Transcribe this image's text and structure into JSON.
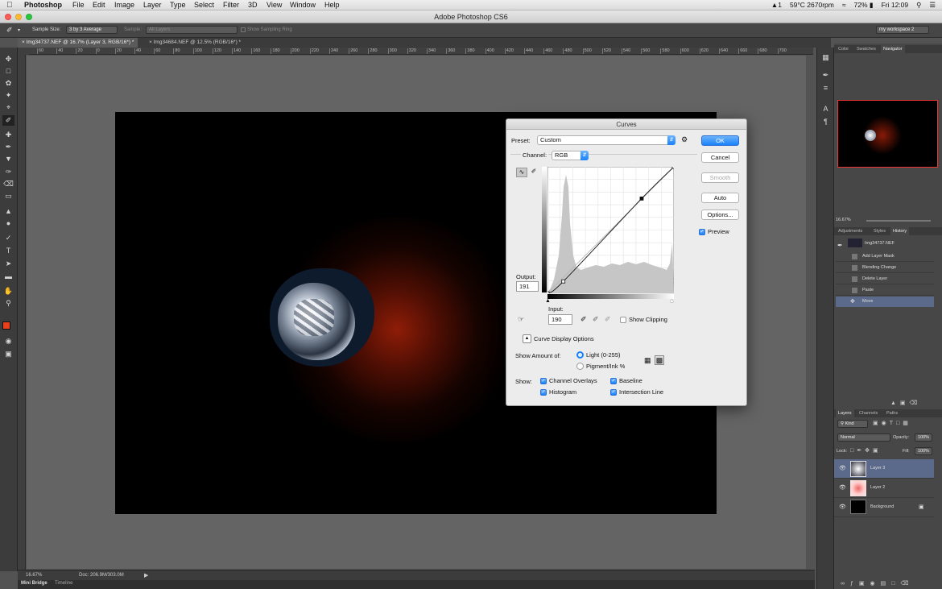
{
  "menubar": {
    "app": "Photoshop",
    "items": [
      "File",
      "Edit",
      "Image",
      "Layer",
      "Type",
      "Select",
      "Filter",
      "3D",
      "View",
      "Window",
      "Help"
    ],
    "status": {
      "adobe": "1",
      "temp": "59°C 2670rpm",
      "battery": "72%",
      "clock": "Fri 12:09"
    }
  },
  "window": {
    "title": "Adobe Photoshop CS6"
  },
  "options_bar": {
    "sample_size_label": "Sample Size:",
    "sample_size_value": "3 by 3 Average",
    "sample_label": "Sample:",
    "sample_value": "All Layers",
    "show_ring": "Show Sampling Ring",
    "workspace": "my workspace 2"
  },
  "tabs": [
    {
      "label": "Img34737.NEF @ 16.7% (Layer 3, RGB/16*) *"
    },
    {
      "label": "Img34684.NEF @ 12.5% (RGB/16*) *"
    }
  ],
  "ruler_ticks": [
    "60",
    "40",
    "20",
    "0",
    "20",
    "40",
    "60",
    "80",
    "100",
    "120",
    "140",
    "160",
    "180",
    "200",
    "220",
    "240",
    "260",
    "280",
    "300",
    "320",
    "340",
    "360",
    "380",
    "400",
    "420",
    "440",
    "460",
    "480",
    "500",
    "520",
    "540",
    "560",
    "580",
    "600",
    "620",
    "640",
    "660",
    "680",
    "700"
  ],
  "status_bar": {
    "zoom": "16.67%",
    "doc": "Doc: 206.9M/303.0M"
  },
  "bottom_tabs": [
    "Mini Bridge",
    "Timeline"
  ],
  "nav_panel": {
    "tabs": [
      "Color",
      "Swatches",
      "Navigator"
    ],
    "zoom": "16.67%"
  },
  "history_panel": {
    "tabs": [
      "Adjustments",
      "Styles",
      "History"
    ],
    "snapshot": "Img34737.NEF",
    "items": [
      "Add Layer Mask",
      "Blending Change",
      "Delete Layer",
      "Paste",
      "Move"
    ]
  },
  "layers_panel": {
    "tabs": [
      "Layers",
      "Channels",
      "Paths"
    ],
    "kind": "Kind",
    "blend_mode": "Normal",
    "opacity_label": "Opacity:",
    "opacity": "100%",
    "lock_label": "Lock:",
    "fill_label": "Fill:",
    "fill": "100%",
    "layers": [
      {
        "name": "Layer 3",
        "selected": true
      },
      {
        "name": "Layer 2",
        "selected": false
      },
      {
        "name": "Background",
        "selected": false
      }
    ]
  },
  "curves": {
    "title": "Curves",
    "preset_label": "Preset:",
    "preset": "Custom",
    "channel_label": "Channel:",
    "channel": "RGB",
    "output_label": "Output:",
    "output": "191",
    "input_label": "Input:",
    "input": "190",
    "show_clipping": "Show Clipping",
    "buttons": {
      "ok": "OK",
      "cancel": "Cancel",
      "smooth": "Smooth",
      "auto": "Auto",
      "options": "Options..."
    },
    "preview": "Preview",
    "display_options": "Curve Display Options",
    "show_amount_label": "Show Amount of:",
    "light": "Light  (0-255)",
    "pigment": "Pigment/Ink %",
    "show_label": "Show:",
    "checks": {
      "channel_overlays": "Channel Overlays",
      "baseline": "Baseline",
      "histogram": "Histogram",
      "intersection": "Intersection Line"
    },
    "curve_points": [
      [
        0,
        0
      ],
      [
        32,
        24
      ],
      [
        190,
        191
      ],
      [
        255,
        255
      ]
    ]
  },
  "colors": {
    "accent": "#1a82fb",
    "foreground": "#e8401c",
    "selection": "#5b6a8a"
  }
}
